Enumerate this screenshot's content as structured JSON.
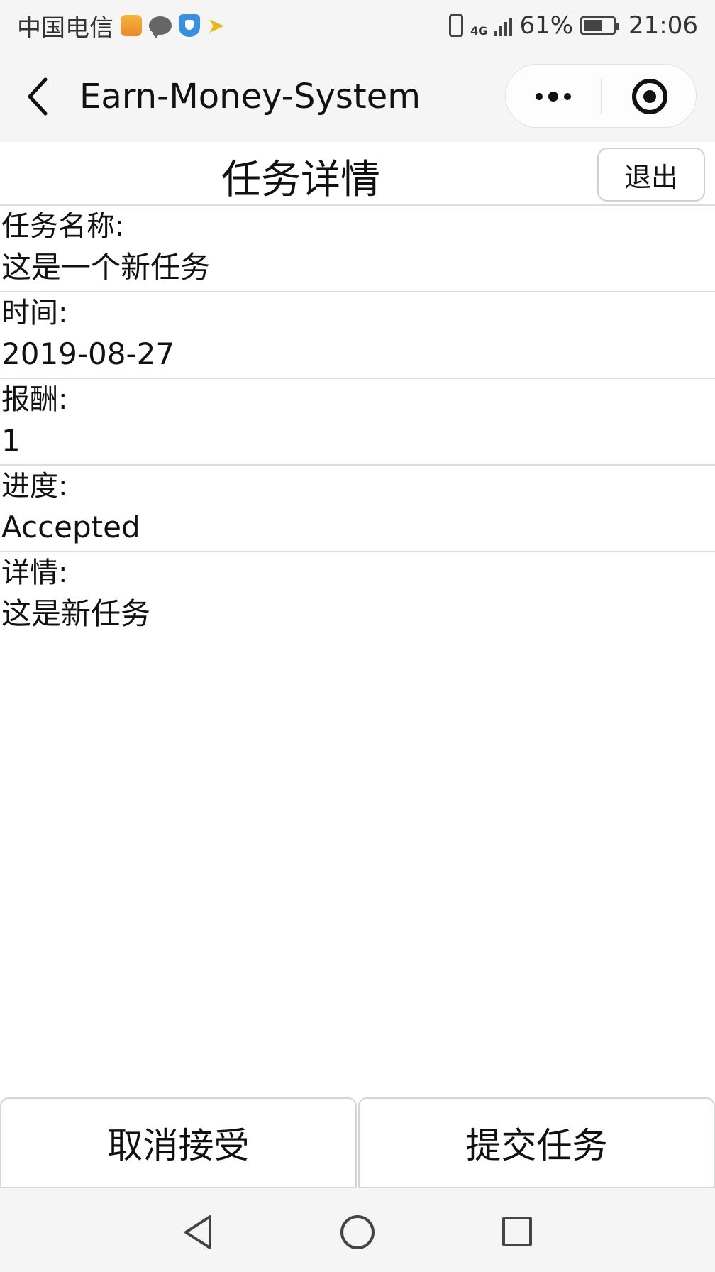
{
  "status_bar": {
    "carrier": "中国电信",
    "network": "4G",
    "battery_percent": "61%",
    "time": "21:06",
    "battery_level": 0.61
  },
  "nav_bar": {
    "title": "Earn-Money-System"
  },
  "header": {
    "title": "任务详情",
    "logout_label": "退出"
  },
  "details": [
    {
      "label": "任务名称:",
      "value": "这是一个新任务"
    },
    {
      "label": "时间:",
      "value": "2019-08-27"
    },
    {
      "label": "报酬:",
      "value": "1"
    },
    {
      "label": "进度:",
      "value": "Accepted"
    },
    {
      "label": "详情:",
      "value": "这是新任务"
    }
  ],
  "actions": {
    "cancel_label": "取消接受",
    "submit_label": "提交任务"
  },
  "colors": {
    "bar_background": "#f5f5f5",
    "divider": "#dddddd",
    "text": "#111111"
  }
}
